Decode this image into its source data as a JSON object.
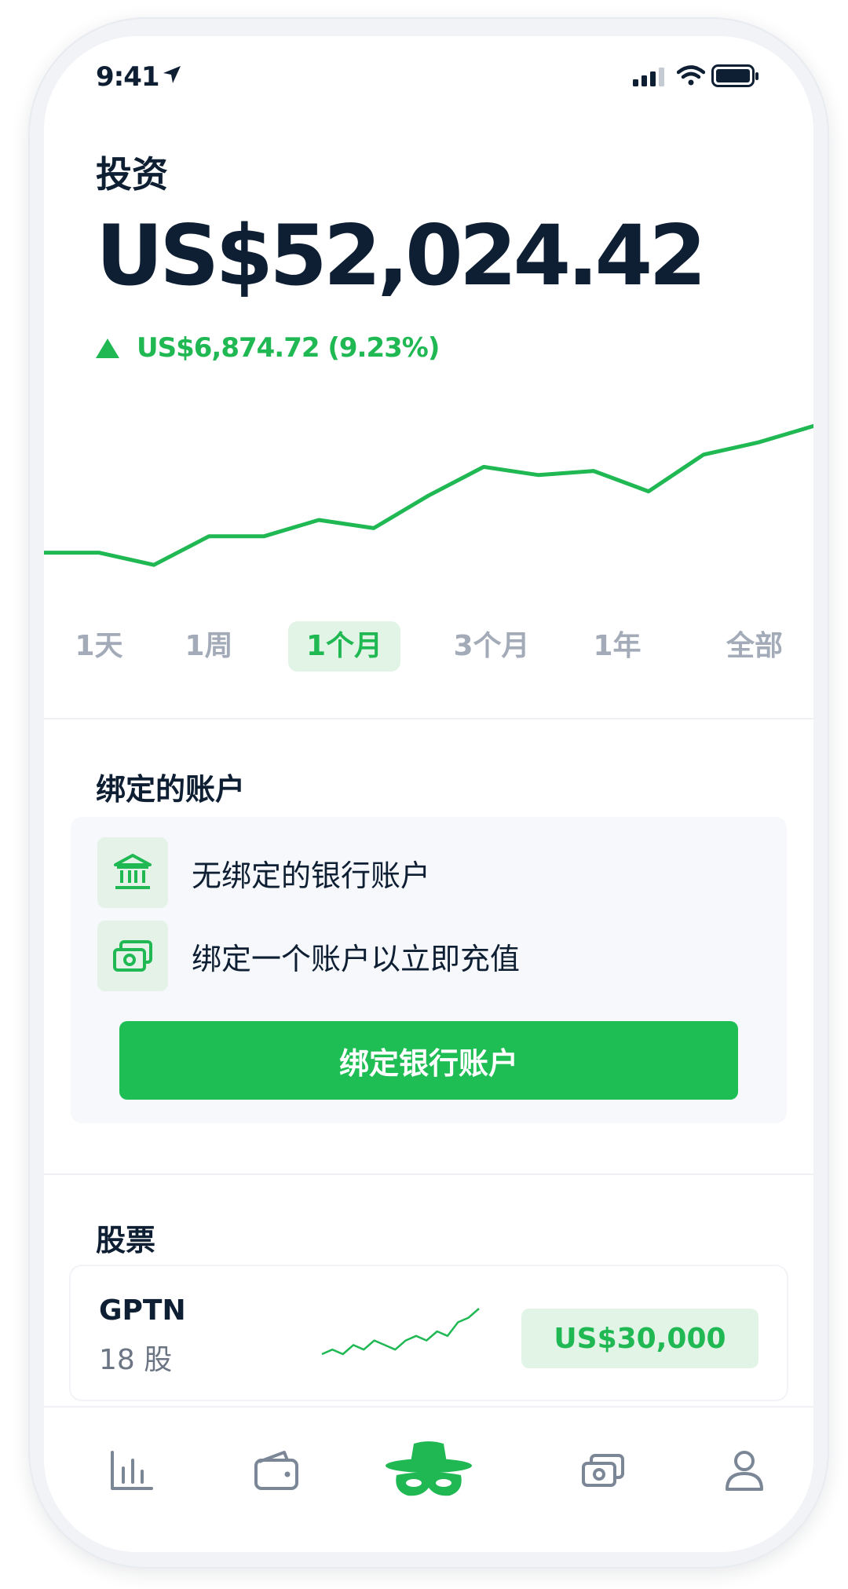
{
  "status_bar": {
    "time": "9:41"
  },
  "header": {
    "title": "投资",
    "balance": "US$52,024.42",
    "gain": "US$6,874.72 (9.23%)",
    "gain_direction": "up"
  },
  "chart_data": {
    "type": "line",
    "series": [
      {
        "values": [
          12,
          12,
          9,
          16,
          16,
          20,
          18,
          26,
          33,
          31,
          32,
          27,
          36,
          39,
          43
        ]
      }
    ],
    "color": "#1fb853",
    "grid": false,
    "ylim": [
      0,
      50
    ]
  },
  "periods": {
    "items": [
      "1天",
      "1周",
      "1个月",
      "3个月",
      "1年",
      "全部"
    ],
    "active": "1个月"
  },
  "linked_accounts": {
    "title": "绑定的账户",
    "rows": [
      {
        "icon": "bank-icon",
        "text": "无绑定的银行账户"
      },
      {
        "icon": "cash-icon",
        "text": "绑定一个账户以立即充值"
      }
    ],
    "button_label": "绑定银行账户"
  },
  "stocks": {
    "title": "股票",
    "items": [
      {
        "symbol": "GPTN",
        "shares": "18 股",
        "value": "US$30,000",
        "trend": [
          2,
          3,
          2,
          4,
          3,
          5,
          4,
          3,
          5,
          6,
          5,
          7,
          6,
          9,
          10,
          12
        ]
      }
    ]
  },
  "tab_bar": {
    "tabs": [
      {
        "icon": "bar-chart-icon",
        "active": false
      },
      {
        "icon": "wallet-icon",
        "active": false
      },
      {
        "icon": "incognito-icon",
        "active": true
      },
      {
        "icon": "cash-icon",
        "active": false
      },
      {
        "icon": "user-icon",
        "active": false
      }
    ]
  },
  "colors": {
    "accent": "#1fb853",
    "text_primary": "#0f1f33",
    "text_muted": "#a3abb8",
    "icon_gray": "#7b8797"
  }
}
